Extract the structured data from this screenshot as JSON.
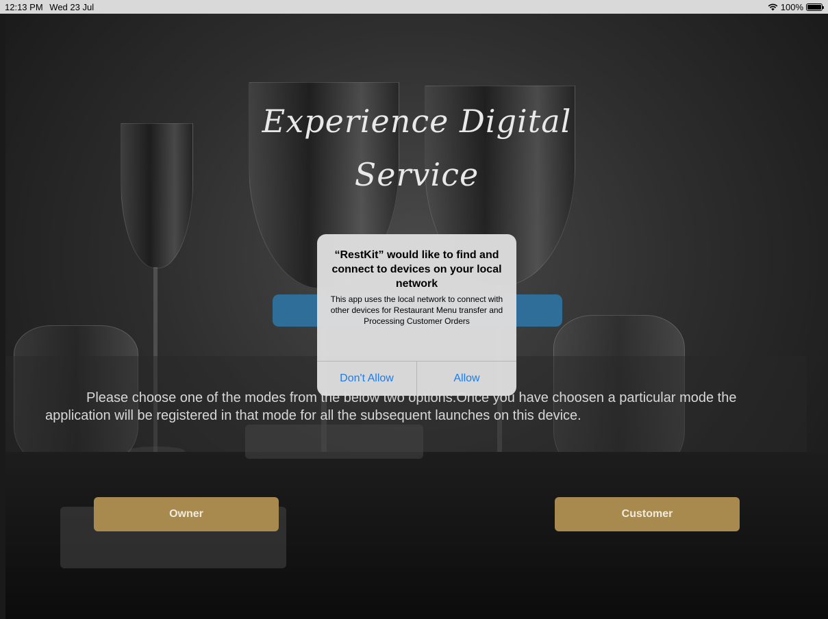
{
  "status_bar": {
    "time": "12:13 PM",
    "date": "Wed 23 Jul",
    "battery": "100%"
  },
  "main": {
    "headline_line1": "Experience Digital",
    "headline_line2": "Service",
    "description": "Please choose one of the modes from the below two options.Once you have choosen a particular mode the application will be registered in that mode for all the subsequent launches on this device.",
    "owner_label": "Owner",
    "customer_label": "Customer"
  },
  "alert": {
    "title": "“RestKit” would like to find and connect to devices on your local network",
    "message": "This app uses the local network to connect with other devices for Restaurant Menu transfer and Processing Customer Orders",
    "deny_label": "Don't Allow",
    "allow_label": "Allow"
  },
  "colors": {
    "gold_button": "#a88a4f",
    "blue_button": "#2f6e98",
    "alert_action": "#1a7cf0"
  },
  "icons": [
    "wifi-icon",
    "battery-icon"
  ]
}
